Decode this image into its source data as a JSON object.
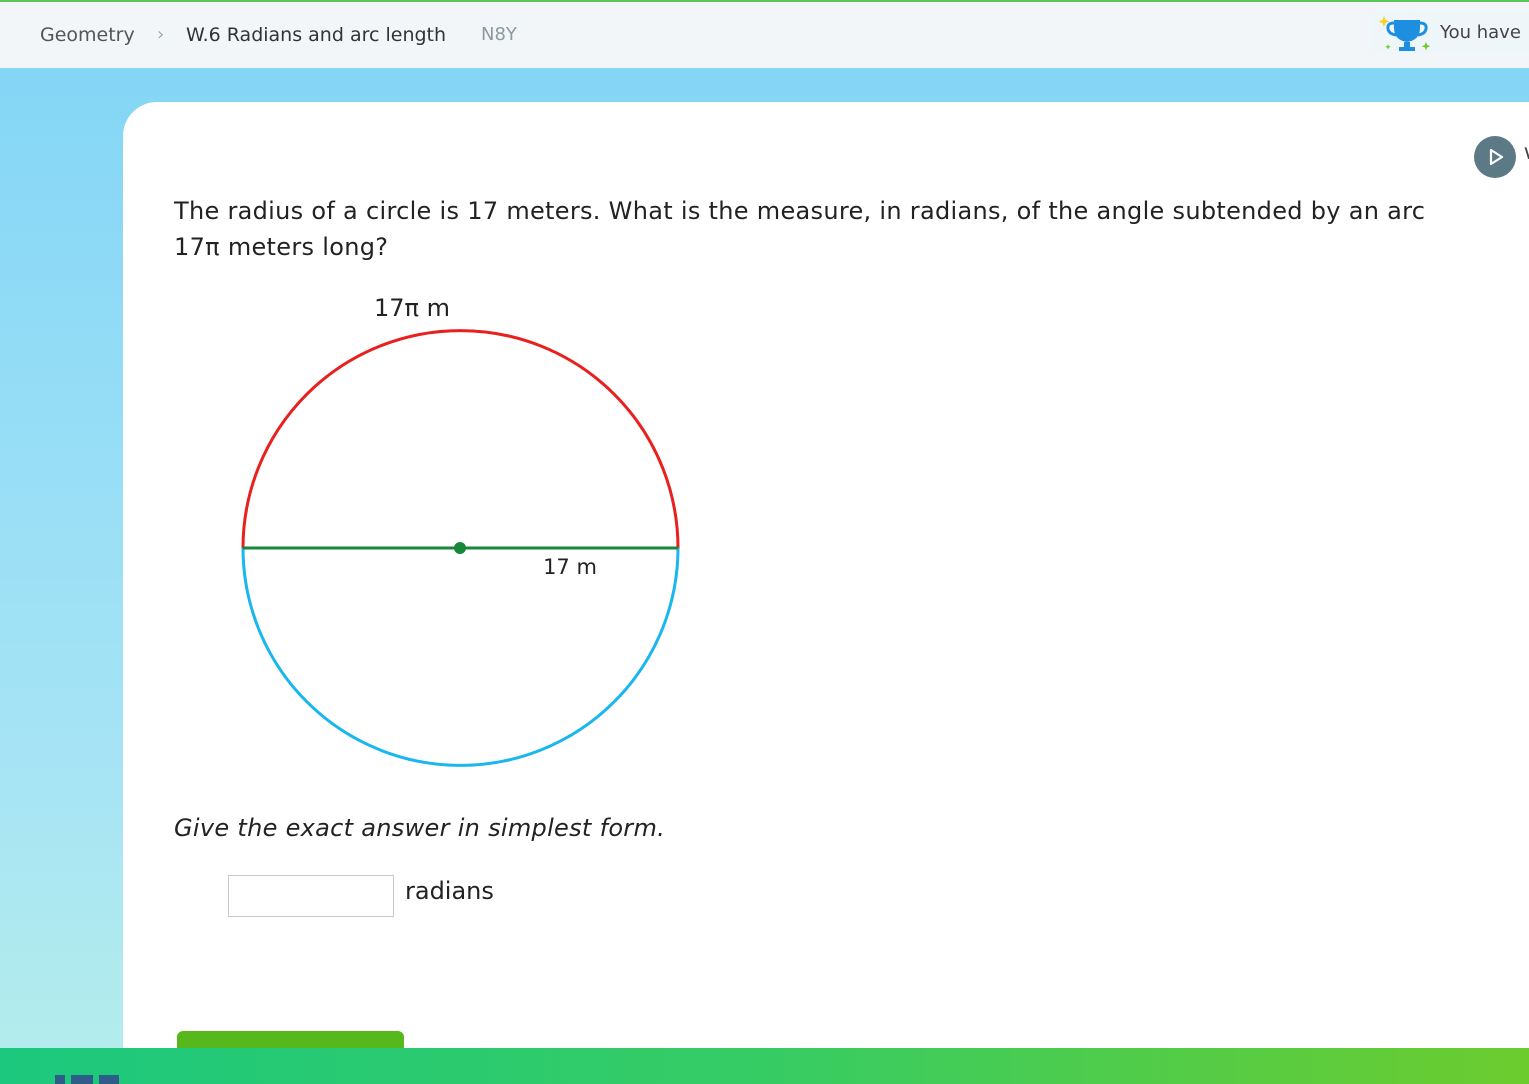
{
  "breadcrumb": {
    "subject": "Geometry",
    "separator": "›",
    "skill": "W.6 Radians and arc length",
    "code": "N8Y"
  },
  "award": {
    "icon": "trophy-icon",
    "text": "You have"
  },
  "colors": {
    "arc_upper": "#e8201e",
    "arc_lower": "#1ab6ee",
    "radius_line": "#17873a",
    "submit_button": "#56b81c"
  },
  "question": {
    "text": "The radius of a circle is 17 meters. What is the measure, in radians, of the angle subtended by an arc 17π meters long?"
  },
  "diagram": {
    "arc_label": "17π m",
    "radius_label": "17 m"
  },
  "instruction": "Give the exact answer in simplest form.",
  "answer": {
    "value": "",
    "unit": "radians"
  }
}
